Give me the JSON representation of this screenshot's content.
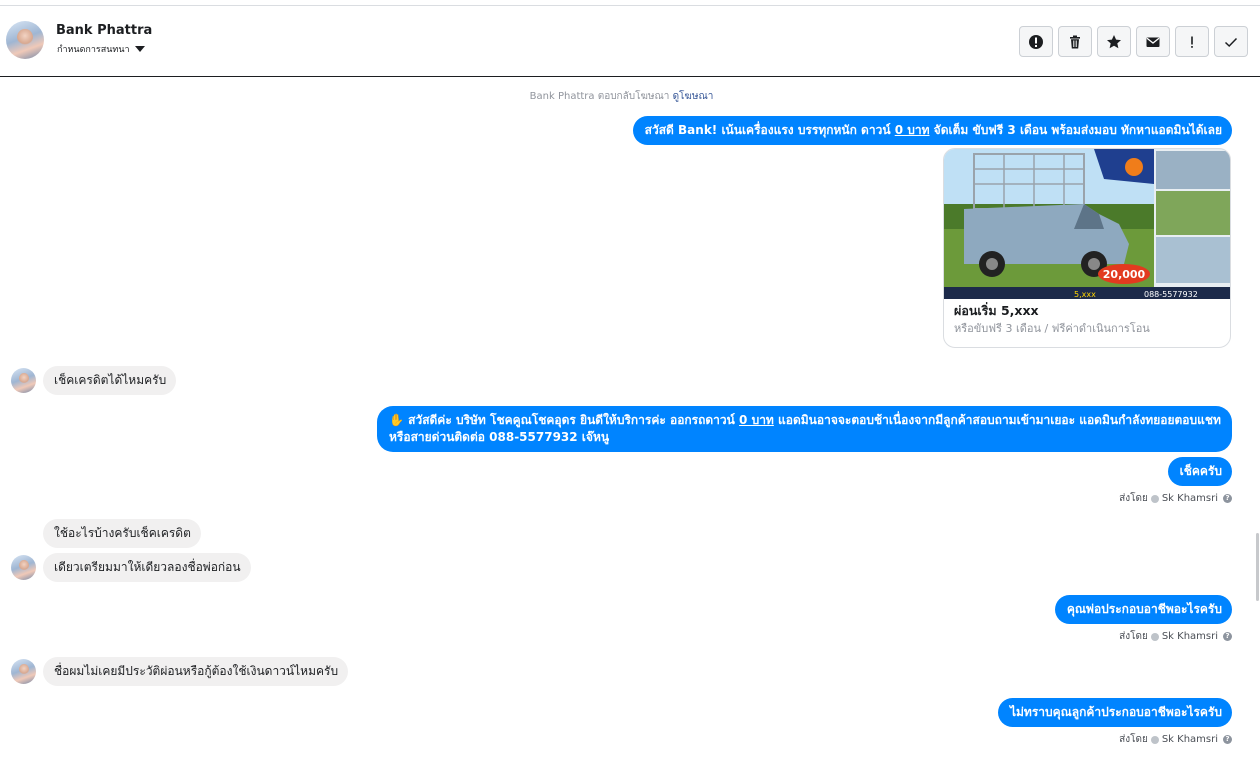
{
  "header": {
    "contact_name": "Bank Phattra",
    "assign_label": "กำหนดการสนทนา",
    "toolbar": [
      {
        "name": "spam-button",
        "icon": "alert-circle-icon"
      },
      {
        "name": "delete-button",
        "icon": "trash-icon"
      },
      {
        "name": "star-button",
        "icon": "star-icon"
      },
      {
        "name": "mark-unread-button",
        "icon": "envelope-icon"
      },
      {
        "name": "follow-up-button",
        "icon": "exclamation-icon"
      },
      {
        "name": "mark-done-button",
        "icon": "check-icon"
      }
    ]
  },
  "notice": {
    "text": "Bank Phattra ตอบกลับโฆษณา",
    "link": "ดูโฆษณา"
  },
  "messages": {
    "m1": {
      "prefix": "สวัสดี Bank! เน้นเครื่องแรง บรรทุกหนัก ดาวน์ ",
      "link": "0 บาท",
      "suffix": " จัดเต็ม ขับฟรี 3 เดือน พร้อมส่งมอบ ทักหาแอดมินได้เลย"
    },
    "card": {
      "title": "ผ่อนเริ่ม 5,xxx",
      "subtitle": "หรือขับฟรี 3 เดือน / ฟรีค่าดำเนินการโอน",
      "img_price": "20,000",
      "img_phone": "088-5577932",
      "img_installment": "5,xxx"
    },
    "m2": "เช็คเครดิตได้ไหมครับ",
    "m3": {
      "wave": "✋",
      "line1_prefix": " สวัสดีค่ะ บริษัท โชคคูณโชคอุดร ยินดีให้บริการค่ะ ออกรถดาวน์ ",
      "line1_link": "0 บาท",
      "line1_suffix": " แอดมินอาจจะตอบช้าเนื่องจากมีลูกค้าสอบถามเข้ามาเยอะ แอดมินกำลังทยอยตอบแชท",
      "line2": "หรือสายด่วนติดต่อ 088-5577932 เจ๊หนู"
    },
    "m4": "เช็คครับ",
    "m5": "ใช้อะไรบ้างครับเช็คเครดิต",
    "m6": "เดียวเตรียมมาให้เดียวลองชื่อพ่อก่อน",
    "m7": "คุณพ่อประกอบอาชีพอะไรครับ",
    "m8": "ชื่อผมไม่เคยมีประวัติผ่อนหรือกู้ต้องใช้เงินดาวน์ไหมครับ",
    "m9": "ไม่ทราบคุณลูกค้าประกอบอาชีพอะไรครับ"
  },
  "sent_by": {
    "label": "ส่งโดย",
    "name": "Sk Khamsri",
    "help": "?"
  },
  "colors": {
    "outgoing": "#0084ff",
    "incoming": "#f1f0f0",
    "link": "#385898"
  }
}
